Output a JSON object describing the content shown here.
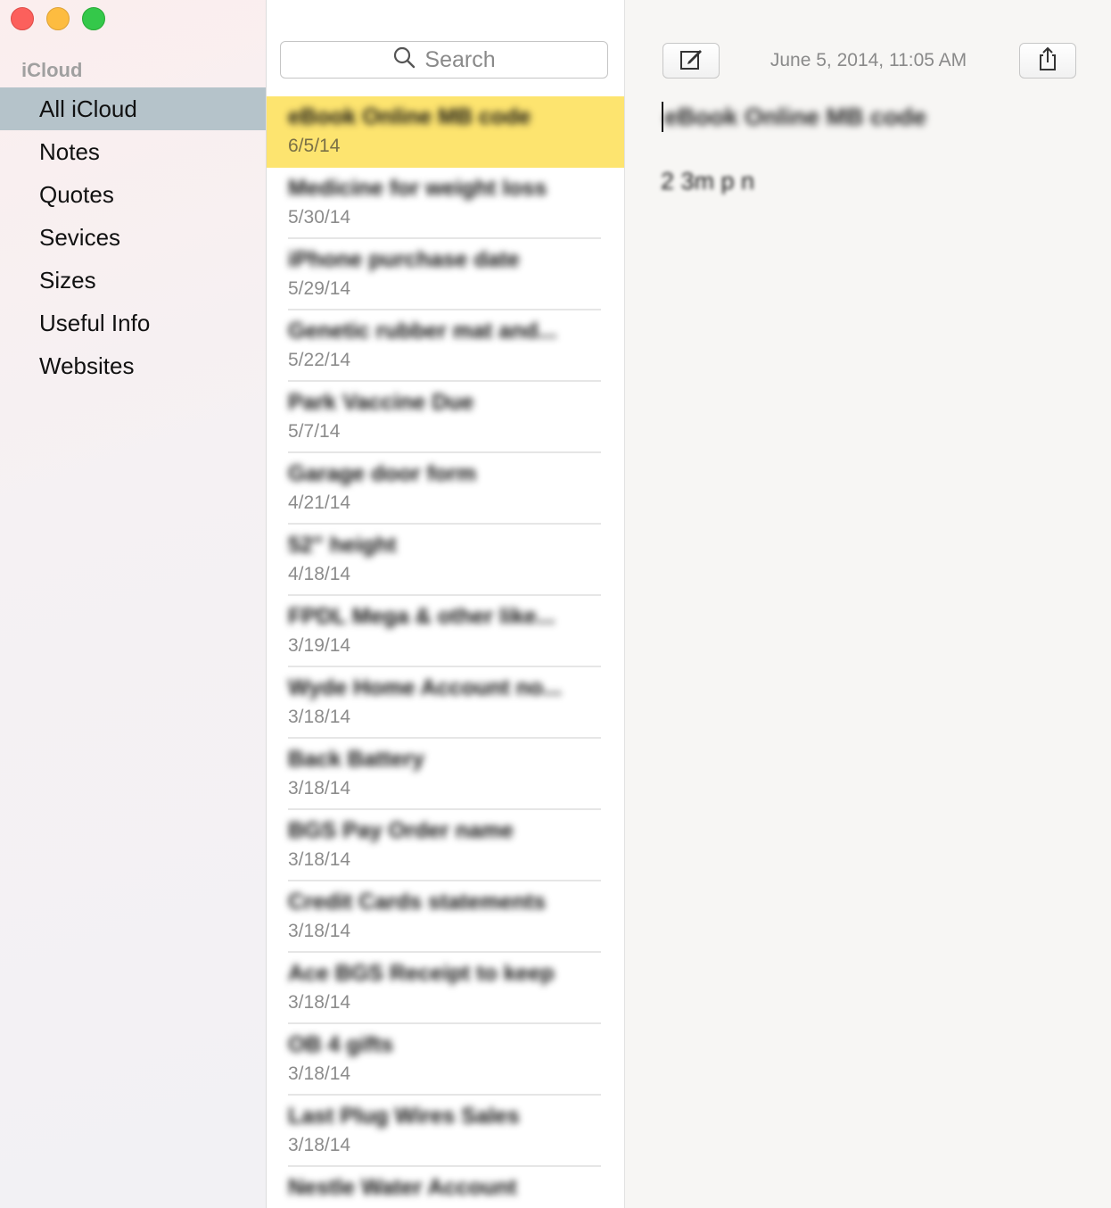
{
  "sidebar": {
    "account_header": "iCloud",
    "folders": [
      {
        "label": "All iCloud"
      },
      {
        "label": "Notes"
      },
      {
        "label": "Quotes"
      },
      {
        "label": "Sevices"
      },
      {
        "label": "Sizes"
      },
      {
        "label": "Useful Info"
      },
      {
        "label": "Websites"
      }
    ],
    "selected_index": 0
  },
  "search": {
    "placeholder": "Search",
    "icon": "search-icon"
  },
  "notes": [
    {
      "title": "eBook Online MB code",
      "date": "6/5/14"
    },
    {
      "title": "Medicine for weight loss",
      "date": "5/30/14"
    },
    {
      "title": "iPhone purchase date",
      "date": "5/29/14"
    },
    {
      "title": "Genetic rubber mat and...",
      "date": "5/22/14"
    },
    {
      "title": "Park Vaccine Due",
      "date": "5/7/14"
    },
    {
      "title": "Garage door form",
      "date": "4/21/14"
    },
    {
      "title": "52\" height",
      "date": "4/18/14"
    },
    {
      "title": "FPDL Mega & other like...",
      "date": "3/19/14"
    },
    {
      "title": "Wyde Home Account no...",
      "date": "3/18/14"
    },
    {
      "title": "Back Battery",
      "date": "3/18/14"
    },
    {
      "title": "BGS Pay Order name",
      "date": "3/18/14"
    },
    {
      "title": "Credit Cards statements",
      "date": "3/18/14"
    },
    {
      "title": "Ace BGS Receipt to keep",
      "date": "3/18/14"
    },
    {
      "title": "OB 4 gifts",
      "date": "3/18/14"
    },
    {
      "title": "Last Plug Wires Sales",
      "date": "3/18/14"
    },
    {
      "title": "Nestle Water Account",
      "date": ""
    }
  ],
  "editor": {
    "timestamp": "June 5, 2014, 11:05 AM",
    "compose_icon": "compose-icon",
    "share_icon": "share-icon",
    "body_line1": "eBook Online MB code",
    "body_line2": "2 3m p n"
  },
  "colors": {
    "selected_note": "#fde46f",
    "selected_folder": "#b5c3ca",
    "close": "#fc605c",
    "minimize": "#fdbc40",
    "maximize": "#34c84a"
  }
}
